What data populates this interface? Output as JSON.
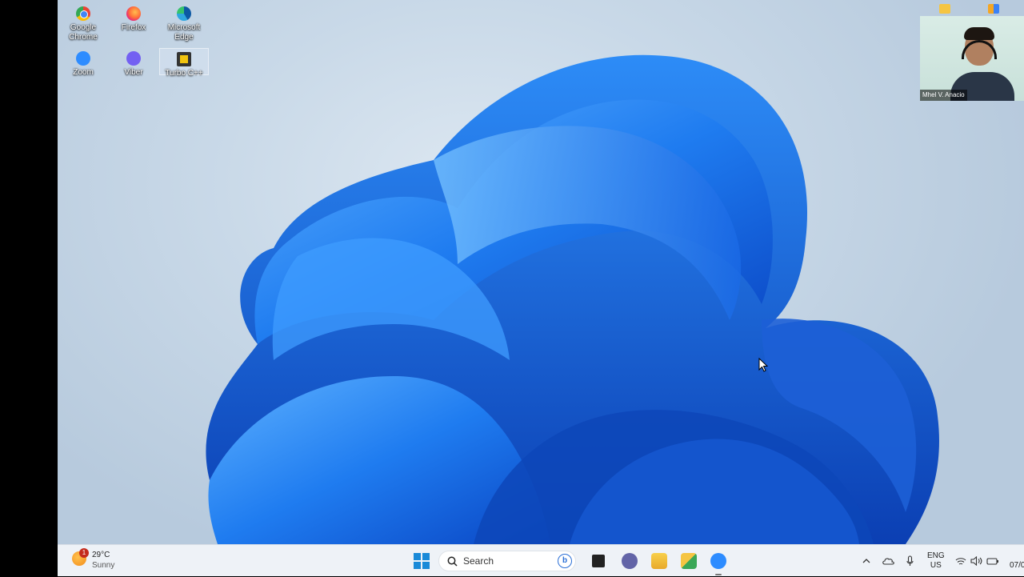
{
  "desktop": {
    "icons": [
      {
        "label": "Google Chrome",
        "icon": "chrome-icon"
      },
      {
        "label": "Firefox",
        "icon": "firefox-icon"
      },
      {
        "label": "Microsoft Edge",
        "icon": "edge-icon"
      },
      {
        "label": "Zoom",
        "icon": "zoom-icon"
      },
      {
        "label": "Viber",
        "icon": "viber-icon"
      },
      {
        "label": "Turbo C++",
        "icon": "turbo-cpp-icon"
      }
    ]
  },
  "webcam": {
    "participant_name": "Mhel V. Anacio"
  },
  "taskbar": {
    "weather": {
      "temp": "29°C",
      "condition": "Sunny",
      "badge": "1"
    },
    "search_label": "Search",
    "tray": {
      "lang_line1": "ENG",
      "lang_line2": "US",
      "date_partial": "07/0"
    }
  },
  "colors": {
    "wallpaper_blue": "#1a6fe6",
    "taskbar_bg": "#eef2f7",
    "accent": "#1a8ad8"
  }
}
